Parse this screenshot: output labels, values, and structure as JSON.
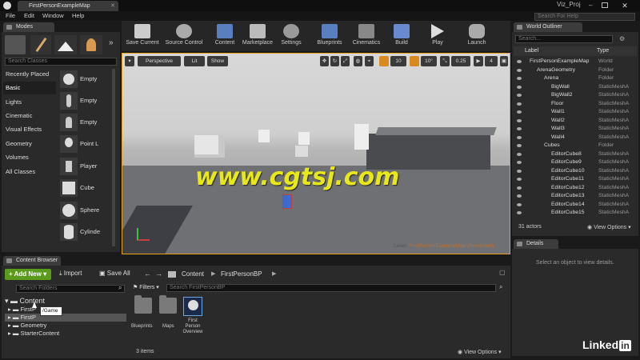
{
  "titlebar": {
    "tab": "FirstPersonExampleMap",
    "project": "Viz_Proj",
    "help_search": "Search For Help"
  },
  "menu": [
    "File",
    "Edit",
    "Window",
    "Help"
  ],
  "modes": {
    "tab": "Modes",
    "search_placeholder": "Search Classes",
    "categories": [
      "Recently Placed",
      "Basic",
      "Lights",
      "Cinematic",
      "Visual Effects",
      "Geometry",
      "Volumes",
      "All Classes"
    ],
    "actors": [
      "Empty",
      "Empty",
      "Empty",
      "Point L",
      "Player",
      "Cube",
      "Sphere",
      "Cylinde"
    ]
  },
  "toolbar": [
    "Save Current",
    "Source Control",
    "Content",
    "Marketplace",
    "Settings",
    "Blueprints",
    "Cinematics",
    "Build",
    "Play",
    "Launch"
  ],
  "viewport": {
    "perspective": "Perspective",
    "lit": "Lit",
    "show": "Show",
    "snap_grid": "10",
    "snap_rot": "10°",
    "snap_scale": "0.25",
    "cam_speed": "4",
    "level_prefix": "Level: ",
    "level_name": "FirstPersonExampleMap (Persistent)",
    "watermark": "www.cgtsj.com"
  },
  "outliner": {
    "tab": "World Outliner",
    "search_placeholder": "Search...",
    "col_label": "Label",
    "col_type": "Type",
    "rows": [
      {
        "label": "FirstPersonExampleMap",
        "type": "World",
        "indent": 0
      },
      {
        "label": "ArenaGeometry",
        "type": "Folder",
        "indent": 1
      },
      {
        "label": "Arena",
        "type": "Folder",
        "indent": 2
      },
      {
        "label": "BigWall",
        "type": "StaticMeshA",
        "indent": 3
      },
      {
        "label": "BigWall2",
        "type": "StaticMeshA",
        "indent": 3
      },
      {
        "label": "Floor",
        "type": "StaticMeshA",
        "indent": 3
      },
      {
        "label": "Wall1",
        "type": "StaticMeshA",
        "indent": 3
      },
      {
        "label": "Wall2",
        "type": "StaticMeshA",
        "indent": 3
      },
      {
        "label": "Wall3",
        "type": "StaticMeshA",
        "indent": 3
      },
      {
        "label": "Wall4",
        "type": "StaticMeshA",
        "indent": 3
      },
      {
        "label": "Cubes",
        "type": "Folder",
        "indent": 2
      },
      {
        "label": "EditorCube8",
        "type": "StaticMeshA",
        "indent": 3
      },
      {
        "label": "EditorCube9",
        "type": "StaticMeshA",
        "indent": 3
      },
      {
        "label": "EditorCube10",
        "type": "StaticMeshA",
        "indent": 3
      },
      {
        "label": "EditorCube11",
        "type": "StaticMeshA",
        "indent": 3
      },
      {
        "label": "EditorCube12",
        "type": "StaticMeshA",
        "indent": 3
      },
      {
        "label": "EditorCube13",
        "type": "StaticMeshA",
        "indent": 3
      },
      {
        "label": "EditorCube14",
        "type": "StaticMeshA",
        "indent": 3
      },
      {
        "label": "EditorCube15",
        "type": "StaticMeshA",
        "indent": 3
      }
    ],
    "actor_count": "31 actors",
    "view_options": "View Options"
  },
  "details": {
    "tab": "Details",
    "empty": "Select an object to view details."
  },
  "content_browser": {
    "tab": "Content Browser",
    "add_new": "Add New",
    "import": "Import",
    "save_all": "Save All",
    "path": [
      "Content",
      "FirstPersonBP"
    ],
    "folder_search": "Search Folders",
    "filters": "Filters",
    "asset_search": "Search FirstPersonBP",
    "tree_root": "Content",
    "tree": [
      "FirstP",
      "FirstP",
      "Geometry",
      "StarterContent"
    ],
    "tooltip": "/Game",
    "assets": [
      "Blueprints",
      "Maps",
      "First Person Overview"
    ],
    "item_count": "3 items",
    "view_options": "View Options"
  },
  "brand": {
    "linked": "Linked",
    "in": "in"
  },
  "colors": {
    "accent_yellow": "#e8e818",
    "add_new_green": "#5a9a1c",
    "link_blue": "#6fa8dc",
    "level_name": "#e0a050"
  }
}
